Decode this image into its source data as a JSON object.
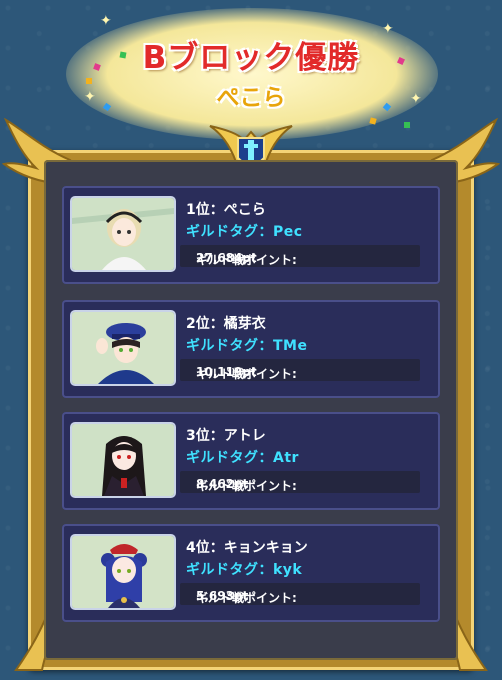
{
  "header": {
    "title": "Bブロック優勝",
    "winner": "ぺこら"
  },
  "rankings": [
    {
      "rank": "1位",
      "name": "ぺこら",
      "tag_label": "ギルドタグ",
      "tag": "Pec",
      "points_label": "ギルド戦ポイント:",
      "points": "27,684pt",
      "avatar_icon": "blonde-girl-avatar"
    },
    {
      "rank": "2位",
      "name": "橘芽衣",
      "tag_label": "ギルドタグ",
      "tag": "TMe",
      "points_label": "ギルド戦ポイント:",
      "points": "10,119pt",
      "avatar_icon": "police-girl-avatar"
    },
    {
      "rank": "3位",
      "name": "アトレ",
      "tag_label": "ギルドタグ",
      "tag": "Atr",
      "points_label": "ギルド戦ポイント:",
      "points": "8,462pt",
      "avatar_icon": "vampire-girl-avatar"
    },
    {
      "rank": "4位",
      "name": "キョンキョン",
      "tag_label": "ギルドタグ",
      "tag": "kyk",
      "points_label": "ギルド戦ポイント:",
      "points": "5,693pt",
      "avatar_icon": "jiangshi-girl-avatar"
    }
  ],
  "colors": {
    "background": "#2d5779",
    "title_red": "#e22a2a",
    "winner_gold": "#e8a40a",
    "tag_cyan": "#3fe1ff",
    "card_bg": "#2a2d5a",
    "frame_gold": "#b48a2c"
  }
}
